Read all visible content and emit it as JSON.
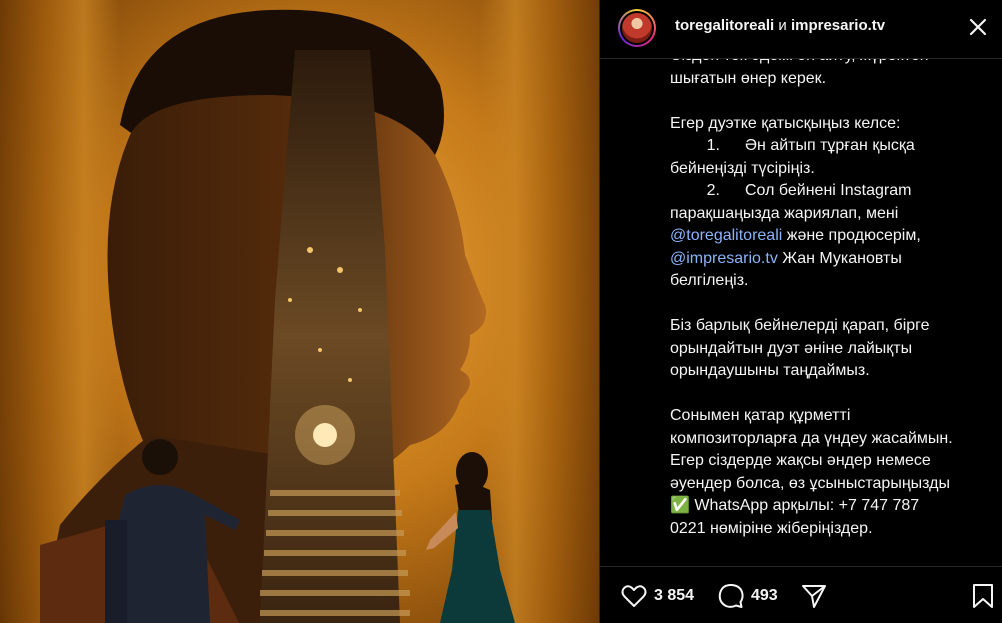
{
  "post": {
    "header": {
      "account_1": "toregalitoreali",
      "conjunction": "и",
      "account_2": "impresario.tv"
    },
    "caption": {
      "intro_cut": "Сізден тек әдемі ән айту, жүректен",
      "intro_end": "шығатын өнер керек.",
      "join_text": "Егер дуэтке қатысқыңыз келсе:",
      "step1_num": "1.",
      "step1_text": "Ән айтып тұрған қысқа",
      "step1_cont": "бейнеңізді түсіріңіз.",
      "step2_num": "2.",
      "step2_text": "Сол бейнені Instagram",
      "step2_cont": "парақшаңызда жариялап, мені",
      "mention_1": "@toregalitoreali",
      "mention_1_after": " және продюсерім,",
      "mention_2": "@impresario.tv",
      "mention_2_after": " Жан Мукановты",
      "step2_end": "белгілеңіз.",
      "para3_l1": "Біз барлық бейнелерді қарап, бірге",
      "para3_l2": "орындайтын дуэт әніне лайықты",
      "para3_l3": "орындаушыны таңдаймыз.",
      "para4_l1": "Сонымен қатар құрметті",
      "para4_l2": "композиторларға да үндеу жасаймын.",
      "para4_l3": "Егер сіздерде жақсы әндер немесе",
      "para4_l4": "әуендер болса, өз ұсыныстарыңызды",
      "para4_emoji": "✅",
      "para4_l5": " WhatsApp арқылы: +7 747 787",
      "para4_l6": "0221 нөміріне жіберіңіздер."
    },
    "actions": {
      "likes": "3 854",
      "comments": "493"
    },
    "icons": {
      "like": "heart-icon",
      "comment": "comment-bubble-icon",
      "share": "paper-plane-icon",
      "save": "bookmark-icon",
      "more": "close-x-icon"
    }
  }
}
